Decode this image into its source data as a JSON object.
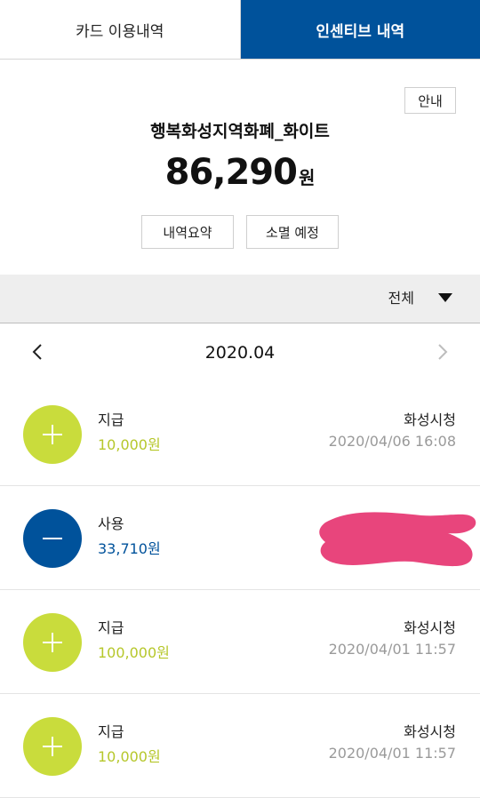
{
  "tabs": [
    {
      "label": "카드 이용내역",
      "active": false
    },
    {
      "label": "인센티브 내역",
      "active": true
    }
  ],
  "summary": {
    "guide_label": "안내",
    "card_name": "행복화성지역화폐_화이트",
    "balance": "86,290",
    "balance_unit": "원",
    "history_summary_label": "내역요약",
    "expiry_label": "소멸 예정"
  },
  "filter": {
    "label": "전체",
    "icon": "caret-down-icon"
  },
  "month_nav": {
    "label": "2020.04",
    "prev_icon": "chevron-left-icon",
    "next_icon": "chevron-right-icon"
  },
  "transactions": [
    {
      "type": "지급",
      "amount": "10,000원",
      "place": "화성시청",
      "datetime": "2020/04/06 16:08",
      "kind": "plus"
    },
    {
      "type": "사용",
      "amount": "33,710원",
      "place": "",
      "datetime": "",
      "kind": "minus",
      "redacted": true
    },
    {
      "type": "지급",
      "amount": "100,000원",
      "place": "화성시청",
      "datetime": "2020/04/01 11:57",
      "kind": "plus"
    },
    {
      "type": "지급",
      "amount": "10,000원",
      "place": "화성시청",
      "datetime": "2020/04/01 11:57",
      "kind": "plus"
    }
  ],
  "colors": {
    "accent_blue": "#00529b",
    "accent_lime": "#c9dc3c",
    "lime_text": "#b6c72b",
    "redaction": "#e8457c"
  }
}
